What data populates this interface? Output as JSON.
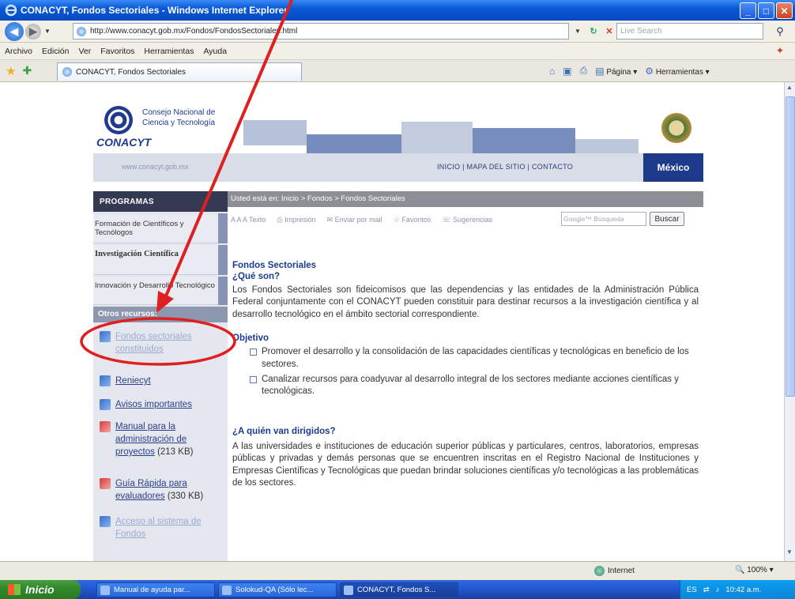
{
  "window": {
    "title": "CONACYT, Fondos Sectoriales - Windows Internet Explorer",
    "url": "http://www.conacyt.gob.mx/Fondos/FondosSectoriales.html",
    "search_placeholder": "Live Search",
    "menu": [
      "Archivo",
      "Edición",
      "Ver",
      "Favoritos",
      "Herramientas",
      "Ayuda"
    ],
    "tab_label": "CONACYT, Fondos Sectoriales",
    "cmd_page": "Página",
    "cmd_tools": "Herramientas"
  },
  "site": {
    "org_line1": "Consejo Nacional de",
    "org_line2": "Ciencia y Tecnología",
    "logo_word": "CONACYT",
    "site_url": "www.conacyt.gob.mx",
    "nav_links": "INICIO | MAPA DEL SITIO | CONTACTO",
    "country": "México"
  },
  "sidebar": {
    "programs_title": "PROGRAMAS",
    "programs": [
      {
        "label": "Formación de Científicos y Tecnólogos"
      },
      {
        "label": "Investigación Científica"
      },
      {
        "label": "Innovación y Desarrollo Tecnológico"
      }
    ],
    "other_title": "Otros recursos:",
    "resources": [
      {
        "label": "Fondos sectoriales constituidos",
        "icon": "document-icon"
      },
      {
        "label": "Reniecyt",
        "icon": "document-icon"
      },
      {
        "label": "Avisos importantes",
        "icon": "document-icon"
      },
      {
        "label": "Manual para la administración de proyectos",
        "size": "(213 KB)",
        "icon": "pdf-icon"
      },
      {
        "label": "Guía Rápida para evaluadores",
        "size": "(330 KB)",
        "icon": "pdf-icon"
      },
      {
        "label": "Acceso al sistema de Fondos",
        "icon": "document-icon"
      }
    ]
  },
  "breadcrumb": {
    "prefix": "Usted está en:",
    "path": "Inicio > Fondos > Fondos Sectoriales"
  },
  "tools": {
    "text_size": "A A A Texto",
    "print": "Impresión",
    "email": "Enviar por mail",
    "favorites": "Favoritos",
    "suggestions": "Sugerencias",
    "search_placeholder": "Google™ Búsqueda",
    "search_button": "Buscar"
  },
  "content": {
    "title": "Fondos Sectoriales",
    "q1": "¿Qué son?",
    "p1": "Los Fondos Sectoriales son fideicomisos que las dependencias y las entidades de la Administración Pública Federal conjuntamente con el CONACYT pueden constituir para destinar recursos a la investigación científica y al desarrollo tecnológico en el ámbito sectorial correspondiente.",
    "objective_title": "Objetivo",
    "objectives": [
      "Promover el desarrollo y la consolidación de las capacidades científicas y tecnológicas en beneficio de los sectores.",
      "Canalizar recursos para coadyuvar al desarrollo integral de los sectores mediante acciones científicas y tecnológicas."
    ],
    "audience_title": "¿A quién van dirigidos?",
    "audience_text": "A las universidades e instituciones de educación superior públicas y particulares, centros, laboratorios, empresas públicas y privadas y demás personas que se encuentren inscritas en el Registro Nacional de Instituciones y Empresas Científicas y Tecnológicas que puedan brindar soluciones científicas y/o tecnológicas a las problemáticas de los sectores."
  },
  "status": {
    "zone": "Internet",
    "zoom": "100%"
  },
  "taskbar": {
    "start": "Inicio",
    "items": [
      {
        "label": "Manual de ayuda par..."
      },
      {
        "label": "Solokud-QA (Sólo lec..."
      },
      {
        "label": "CONACYT, Fondos S..."
      }
    ],
    "lang": "ES",
    "clock": "10:42 a.m."
  }
}
